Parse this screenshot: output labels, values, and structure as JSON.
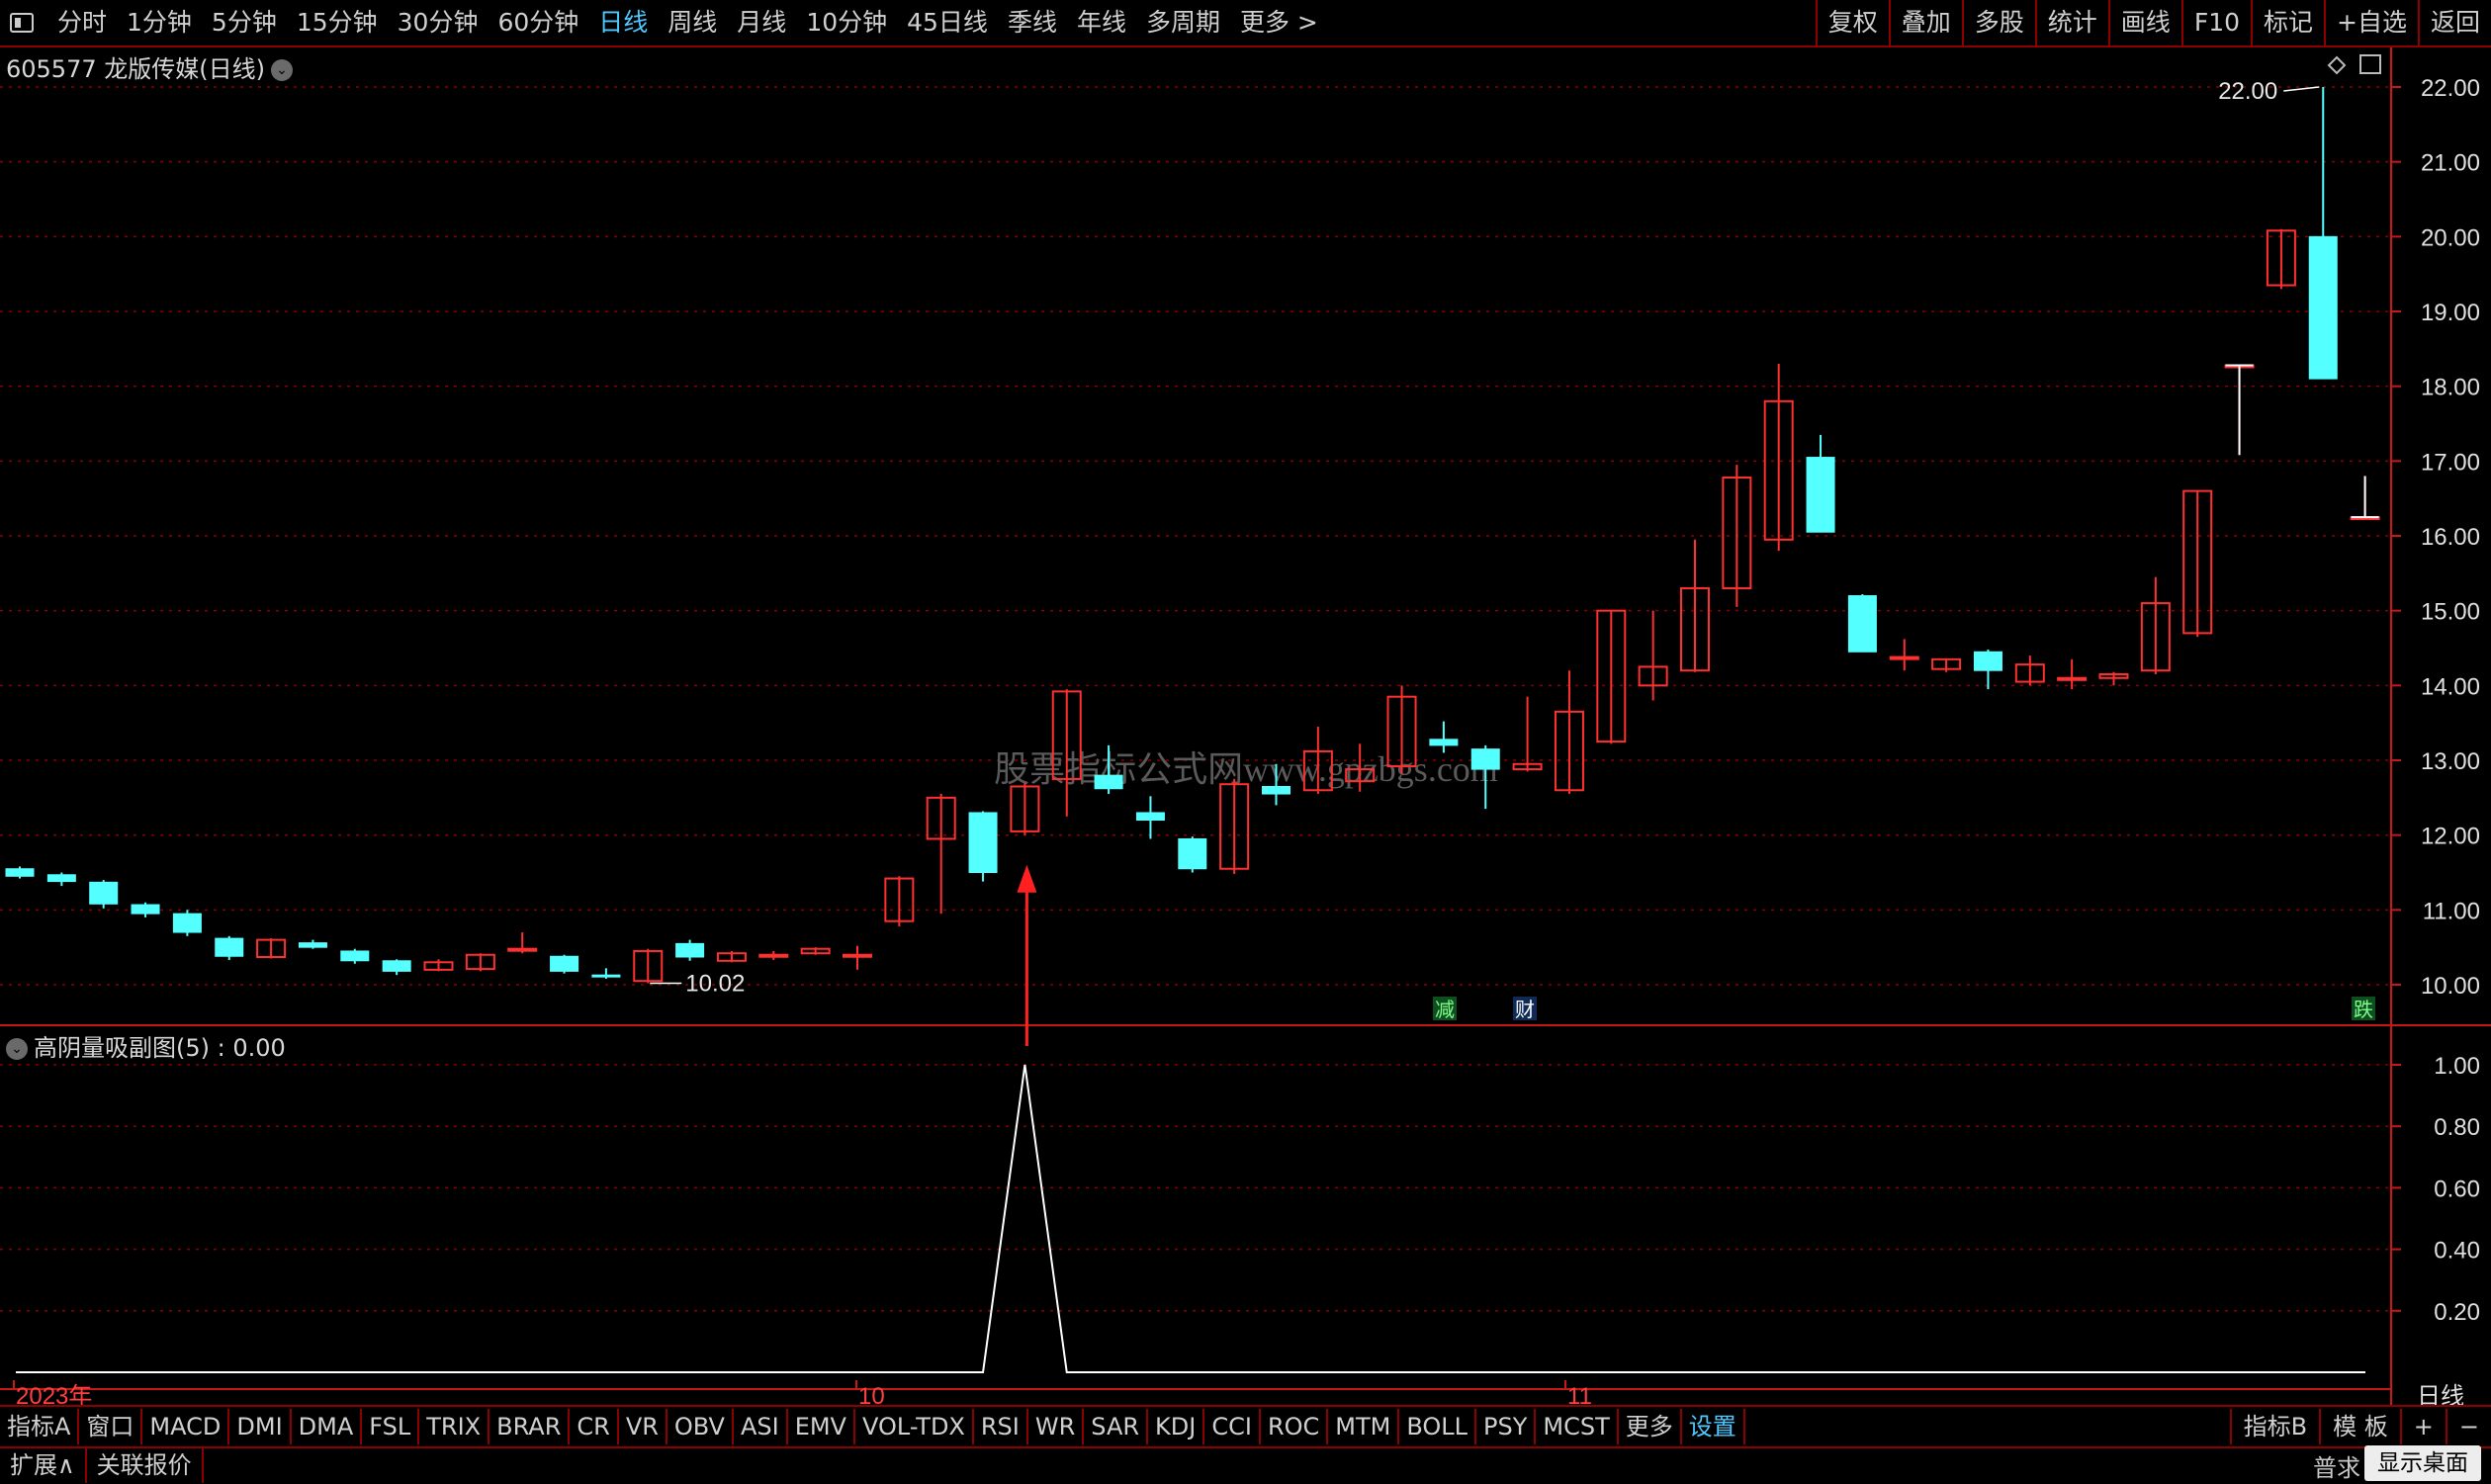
{
  "toolbar": {
    "periods": [
      "分时",
      "1分钟",
      "5分钟",
      "15分钟",
      "30分钟",
      "60分钟",
      "日线",
      "周线",
      "月线",
      "10分钟",
      "45日线",
      "季线",
      "年线",
      "多周期",
      "更多 >"
    ],
    "active_period": "日线",
    "right_buttons": [
      "复权",
      "叠加",
      "多股",
      "统计",
      "画线",
      "F10",
      "标记",
      "+自选",
      "返回"
    ]
  },
  "main_title": "605577 龙版传媒(日线)",
  "sub_title": "高阴量吸副图(5) : 0.00",
  "watermark": "股票指标公式网www.gpzbgs.com",
  "badges": {
    "jian": "减",
    "cai": "财",
    "die": "跌"
  },
  "colors": {
    "up": "#ff3030",
    "down": "#54ffff",
    "grid": "#8b0000",
    "axis": "#c81818",
    "text": "#c8c8c8",
    "line": "#ffffff",
    "label_time": "#ff4040"
  },
  "chart_data": {
    "type": "candlestick",
    "y_ticks": [
      "22.00",
      "21.00",
      "20.00",
      "19.00",
      "18.00",
      "17.00",
      "16.00",
      "15.00",
      "14.00",
      "13.00",
      "12.00",
      "11.00",
      "10.00"
    ],
    "y_range": [
      9.7,
      22.1
    ],
    "annotations": {
      "high": "22.00",
      "low": "10.02"
    },
    "x_labels": [
      "2023年",
      "10",
      "11"
    ],
    "right_label": "日线",
    "candles": [
      {
        "o": 11.55,
        "h": 11.58,
        "l": 11.42,
        "c": 11.45
      },
      {
        "o": 11.47,
        "h": 11.5,
        "l": 11.32,
        "c": 11.38
      },
      {
        "o": 11.37,
        "h": 11.4,
        "l": 11.02,
        "c": 11.08
      },
      {
        "o": 11.07,
        "h": 11.1,
        "l": 10.9,
        "c": 10.95
      },
      {
        "o": 10.95,
        "h": 11.0,
        "l": 10.65,
        "c": 10.7
      },
      {
        "o": 10.62,
        "h": 10.65,
        "l": 10.33,
        "c": 10.38
      },
      {
        "o": 10.37,
        "h": 10.62,
        "l": 10.35,
        "c": 10.6
      },
      {
        "o": 10.56,
        "h": 10.6,
        "l": 10.48,
        "c": 10.5
      },
      {
        "o": 10.45,
        "h": 10.48,
        "l": 10.28,
        "c": 10.32
      },
      {
        "o": 10.32,
        "h": 10.34,
        "l": 10.13,
        "c": 10.18
      },
      {
        "o": 10.2,
        "h": 10.34,
        "l": 10.18,
        "c": 10.3
      },
      {
        "o": 10.21,
        "h": 10.42,
        "l": 10.18,
        "c": 10.4
      },
      {
        "o": 10.48,
        "h": 10.7,
        "l": 10.42,
        "c": 10.48
      },
      {
        "o": 10.38,
        "h": 10.4,
        "l": 10.15,
        "c": 10.18
      },
      {
        "o": 10.13,
        "h": 10.22,
        "l": 10.08,
        "c": 10.12
      },
      {
        "o": 10.05,
        "h": 10.48,
        "l": 10.02,
        "c": 10.45
      },
      {
        "o": 10.55,
        "h": 10.6,
        "l": 10.32,
        "c": 10.37
      },
      {
        "o": 10.32,
        "h": 10.45,
        "l": 10.3,
        "c": 10.42
      },
      {
        "o": 10.4,
        "h": 10.45,
        "l": 10.33,
        "c": 10.4
      },
      {
        "o": 10.42,
        "h": 10.5,
        "l": 10.4,
        "c": 10.48
      },
      {
        "o": 10.4,
        "h": 10.52,
        "l": 10.2,
        "c": 10.4
      },
      {
        "o": 10.85,
        "h": 11.45,
        "l": 10.78,
        "c": 11.42
      },
      {
        "o": 11.95,
        "h": 12.55,
        "l": 10.95,
        "c": 12.5
      },
      {
        "o": 12.3,
        "h": 12.32,
        "l": 11.38,
        "c": 11.5
      },
      {
        "o": 12.05,
        "h": 12.7,
        "l": 12.0,
        "c": 12.65
      },
      {
        "o": 12.75,
        "h": 13.95,
        "l": 12.25,
        "c": 13.92
      },
      {
        "o": 12.8,
        "h": 13.2,
        "l": 12.55,
        "c": 12.62
      },
      {
        "o": 12.3,
        "h": 12.52,
        "l": 11.95,
        "c": 12.2
      },
      {
        "o": 11.95,
        "h": 11.98,
        "l": 11.5,
        "c": 11.55
      },
      {
        "o": 11.55,
        "h": 12.75,
        "l": 11.48,
        "c": 12.68
      },
      {
        "o": 12.65,
        "h": 12.95,
        "l": 12.4,
        "c": 12.55
      },
      {
        "o": 12.6,
        "h": 13.45,
        "l": 12.55,
        "c": 13.12
      },
      {
        "o": 12.72,
        "h": 13.22,
        "l": 12.58,
        "c": 12.88
      },
      {
        "o": 12.92,
        "h": 14.0,
        "l": 12.82,
        "c": 13.85
      },
      {
        "o": 13.28,
        "h": 13.52,
        "l": 13.1,
        "c": 13.2
      },
      {
        "o": 13.15,
        "h": 13.2,
        "l": 12.35,
        "c": 12.88
      },
      {
        "o": 12.88,
        "h": 13.85,
        "l": 12.85,
        "c": 12.95
      },
      {
        "o": 12.6,
        "h": 14.2,
        "l": 12.55,
        "c": 13.65
      },
      {
        "o": 13.25,
        "h": 15.0,
        "l": 13.22,
        "c": 15.0
      },
      {
        "o": 14.0,
        "h": 15.0,
        "l": 13.8,
        "c": 14.25
      },
      {
        "o": 14.2,
        "h": 15.95,
        "l": 14.18,
        "c": 15.3
      },
      {
        "o": 15.3,
        "h": 16.95,
        "l": 15.05,
        "c": 16.78
      },
      {
        "o": 15.95,
        "h": 18.3,
        "l": 15.8,
        "c": 17.8
      },
      {
        "o": 17.05,
        "h": 17.35,
        "l": 16.05,
        "c": 16.05
      },
      {
        "o": 15.2,
        "h": 15.22,
        "l": 14.45,
        "c": 14.45
      },
      {
        "o": 14.38,
        "h": 14.62,
        "l": 14.2,
        "c": 14.38
      },
      {
        "o": 14.22,
        "h": 14.35,
        "l": 14.18,
        "c": 14.35
      },
      {
        "o": 14.45,
        "h": 14.48,
        "l": 13.95,
        "c": 14.2
      },
      {
        "o": 14.05,
        "h": 14.4,
        "l": 14.0,
        "c": 14.28
      },
      {
        "o": 14.1,
        "h": 14.35,
        "l": 13.95,
        "c": 14.1
      },
      {
        "o": 14.1,
        "h": 14.18,
        "l": 14.0,
        "c": 14.15
      },
      {
        "o": 14.2,
        "h": 15.45,
        "l": 14.15,
        "c": 15.1
      },
      {
        "o": 14.7,
        "h": 16.6,
        "l": 14.65,
        "c": 16.6
      },
      {
        "o": 18.28,
        "h": 18.28,
        "l": 17.08,
        "c": 18.28
      },
      {
        "o": 19.35,
        "h": 20.1,
        "l": 19.3,
        "c": 20.08
      },
      {
        "o": 20.0,
        "h": 22.0,
        "l": 18.1,
        "c": 18.1
      },
      {
        "o": 16.25,
        "h": 16.8,
        "l": 16.25,
        "c": 16.25
      }
    ],
    "indicator": {
      "name": "高阴量吸副图(5)",
      "value": "0.00",
      "y_ticks": [
        "1.00",
        "0.80",
        "0.60",
        "0.40",
        "0.20"
      ],
      "y_range": [
        0,
        1.0
      ],
      "series": [
        0,
        0,
        0,
        0,
        0,
        0,
        0,
        0,
        0,
        0,
        0,
        0,
        0,
        0,
        0,
        0,
        0,
        0,
        0,
        0,
        0,
        0,
        0,
        0,
        1,
        0,
        0,
        0,
        0,
        0,
        0,
        0,
        0,
        0,
        0,
        0,
        0,
        0,
        0,
        0,
        0,
        0,
        0,
        0,
        0,
        0,
        0,
        0,
        0,
        0,
        0,
        0,
        0,
        0,
        0,
        0,
        0
      ]
    }
  },
  "bottom_tabs": [
    "指标A",
    "窗口",
    "MACD",
    "DMI",
    "DMA",
    "FSL",
    "TRIX",
    "BRAR",
    "CR",
    "VR",
    "OBV",
    "ASI",
    "EMV",
    "VOL-TDX",
    "RSI",
    "WR",
    "SAR",
    "KDJ",
    "CCI",
    "ROC",
    "MTM",
    "BOLL",
    "PSY",
    "MCST",
    "更多",
    "设置"
  ],
  "bottom_right": [
    "指标B",
    "模 板",
    "+",
    "−"
  ],
  "bottom2": [
    "扩展∧",
    "关联报价"
  ],
  "bottom2_right": "普求",
  "desktop_button": "显示桌面"
}
